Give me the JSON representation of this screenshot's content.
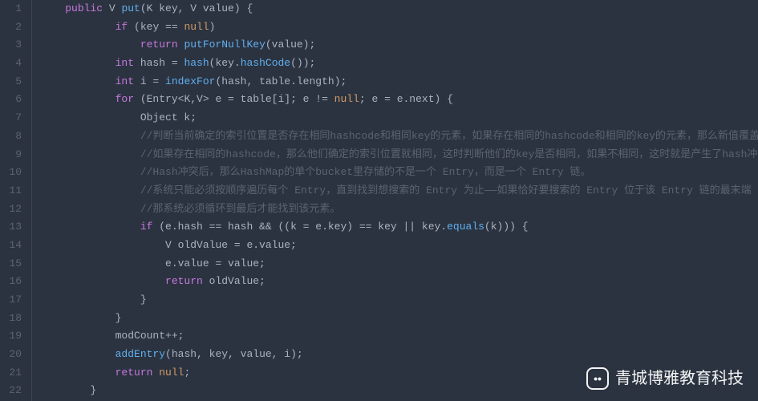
{
  "lines": [
    {
      "n": 1,
      "indent": 1,
      "tokens": [
        [
          "kw",
          "public"
        ],
        [
          "ident",
          " V "
        ],
        [
          "method",
          "put"
        ],
        [
          "punct",
          "(K key, V value) {"
        ]
      ]
    },
    {
      "n": 2,
      "indent": 3,
      "tokens": [
        [
          "kw",
          "if"
        ],
        [
          "punct",
          " (key == "
        ],
        [
          "null",
          "null"
        ],
        [
          "punct",
          ")"
        ]
      ]
    },
    {
      "n": 3,
      "indent": 4,
      "tokens": [
        [
          "kw",
          "return"
        ],
        [
          "punct",
          " "
        ],
        [
          "method",
          "putForNullKey"
        ],
        [
          "punct",
          "(value);"
        ]
      ]
    },
    {
      "n": 4,
      "indent": 3,
      "tokens": [
        [
          "type",
          "int"
        ],
        [
          "punct",
          " hash = "
        ],
        [
          "method",
          "hash"
        ],
        [
          "punct",
          "(key."
        ],
        [
          "method",
          "hashCode"
        ],
        [
          "punct",
          "());"
        ]
      ]
    },
    {
      "n": 5,
      "indent": 3,
      "tokens": [
        [
          "type",
          "int"
        ],
        [
          "punct",
          " i = "
        ],
        [
          "method",
          "indexFor"
        ],
        [
          "punct",
          "(hash, table.length);"
        ]
      ]
    },
    {
      "n": 6,
      "indent": 3,
      "tokens": [
        [
          "kw",
          "for"
        ],
        [
          "punct",
          " (Entry<K,V> e = table[i]; e != "
        ],
        [
          "null",
          "null"
        ],
        [
          "punct",
          "; e = e.next) {"
        ]
      ]
    },
    {
      "n": 7,
      "indent": 4,
      "tokens": [
        [
          "ident",
          "Object k;"
        ]
      ]
    },
    {
      "n": 8,
      "indent": 4,
      "tokens": [
        [
          "comment",
          "//判断当前确定的索引位置是否存在相同hashcode和相同key的元素，如果存在相同的hashcode和相同的key的元素，那么新值覆盖"
        ]
      ]
    },
    {
      "n": 9,
      "indent": 4,
      "tokens": [
        [
          "comment",
          "//如果存在相同的hashcode，那么他们确定的索引位置就相同，这时判断他们的key是否相同，如果不相同，这时就是产生了hash冲"
        ]
      ]
    },
    {
      "n": 10,
      "indent": 4,
      "tokens": [
        [
          "comment",
          "//Hash冲突后，那么HashMap的单个bucket里存储的不是一个 Entry，而是一个 Entry 链。"
        ]
      ]
    },
    {
      "n": 11,
      "indent": 4,
      "tokens": [
        [
          "comment",
          "//系统只能必须按顺序遍历每个 Entry，直到找到想搜索的 Entry 为止——如果恰好要搜索的 Entry 位于该 Entry 链的最末端（"
        ]
      ]
    },
    {
      "n": 12,
      "indent": 4,
      "tokens": [
        [
          "comment",
          "//那系统必须循环到最后才能找到该元素。"
        ]
      ]
    },
    {
      "n": 13,
      "indent": 4,
      "tokens": [
        [
          "kw",
          "if"
        ],
        [
          "punct",
          " (e.hash == hash && ((k = e.key) == key || key."
        ],
        [
          "method",
          "equals"
        ],
        [
          "punct",
          "(k))) {"
        ]
      ]
    },
    {
      "n": 14,
      "indent": 5,
      "tokens": [
        [
          "ident",
          "V oldValue = e.value;"
        ]
      ]
    },
    {
      "n": 15,
      "indent": 5,
      "tokens": [
        [
          "ident",
          "e.value = value;"
        ]
      ]
    },
    {
      "n": 16,
      "indent": 5,
      "tokens": [
        [
          "kw",
          "return"
        ],
        [
          "ident",
          " oldValue;"
        ]
      ]
    },
    {
      "n": 17,
      "indent": 4,
      "tokens": [
        [
          "punct",
          "}"
        ]
      ]
    },
    {
      "n": 18,
      "indent": 3,
      "tokens": [
        [
          "punct",
          "}"
        ]
      ]
    },
    {
      "n": 19,
      "indent": 3,
      "tokens": [
        [
          "ident",
          "modCount++;"
        ]
      ]
    },
    {
      "n": 20,
      "indent": 3,
      "tokens": [
        [
          "method",
          "addEntry"
        ],
        [
          "punct",
          "(hash, key, value, i);"
        ]
      ]
    },
    {
      "n": 21,
      "indent": 3,
      "tokens": [
        [
          "kw",
          "return"
        ],
        [
          "punct",
          " "
        ],
        [
          "null",
          "null"
        ],
        [
          "punct",
          ";"
        ]
      ]
    },
    {
      "n": 22,
      "indent": 2,
      "tokens": [
        [
          "punct",
          "}"
        ]
      ]
    }
  ],
  "watermark": {
    "text": "青城博雅教育科技",
    "icon_glyph": "••"
  }
}
